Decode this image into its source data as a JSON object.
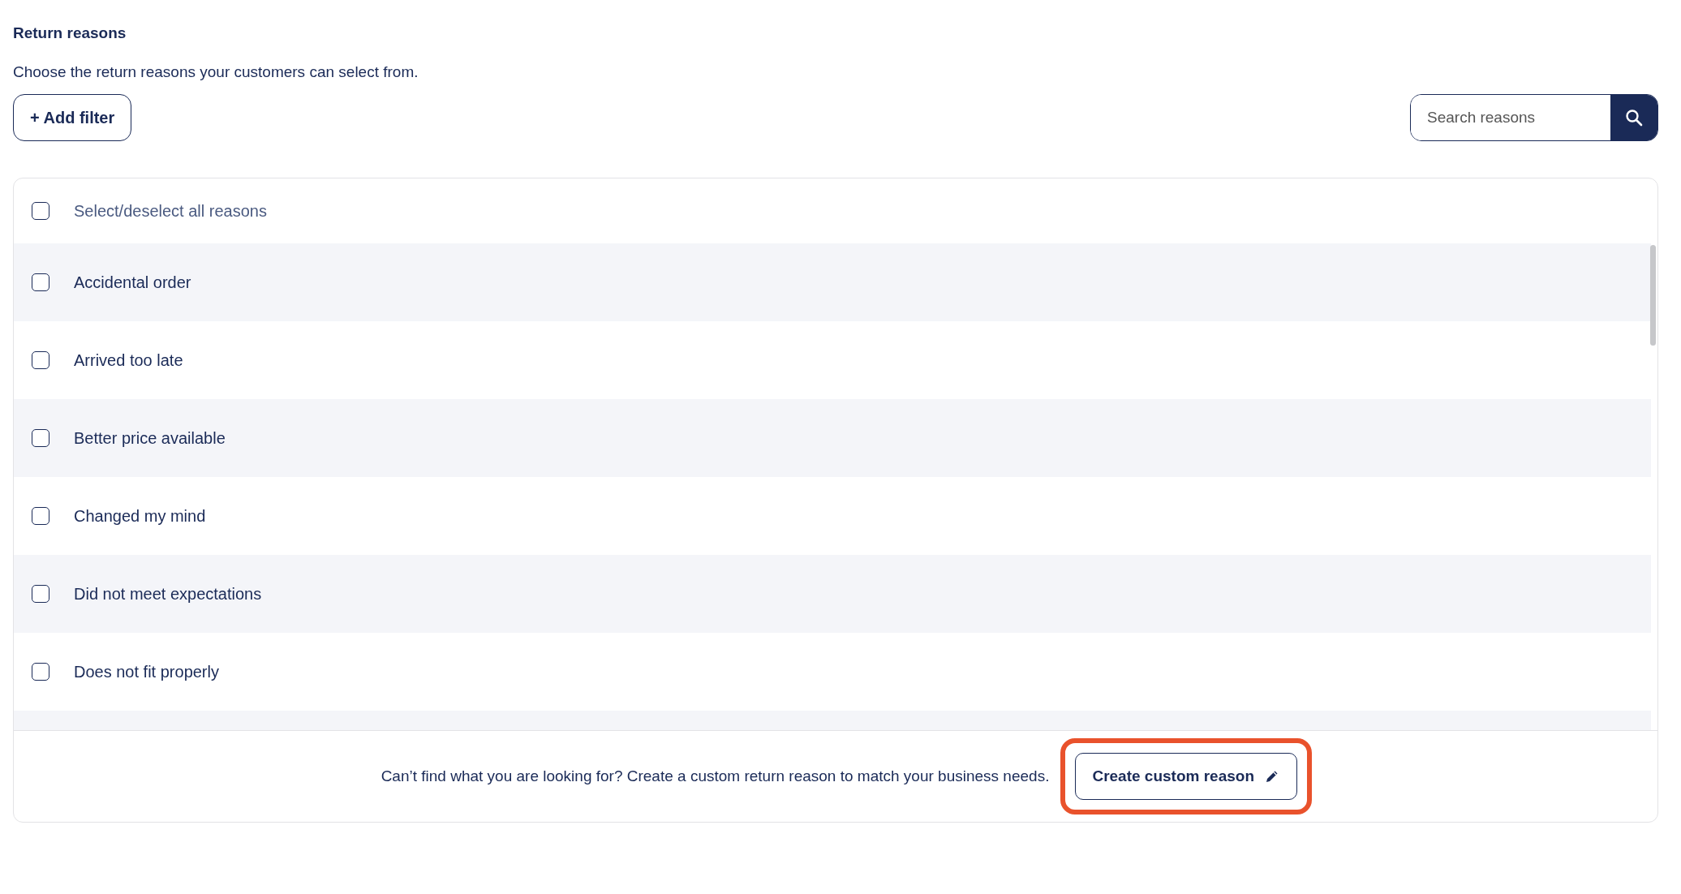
{
  "title": "Return reasons",
  "description": "Choose the return reasons your customers can select from.",
  "add_filter_button": "+ Add filter",
  "search": {
    "placeholder": "Search reasons"
  },
  "select_all": {
    "label": "Select/deselect all reasons",
    "checked": false
  },
  "reasons": [
    {
      "label": "Accidental order",
      "checked": false
    },
    {
      "label": "Arrived too late",
      "checked": false
    },
    {
      "label": "Better price available",
      "checked": false
    },
    {
      "label": "Changed my mind",
      "checked": false
    },
    {
      "label": "Did not meet expectations",
      "checked": false
    },
    {
      "label": "Does not fit properly",
      "checked": false
    }
  ],
  "footer": {
    "text": "Can’t find what you are looking for? Create a custom return reason to match your business needs.",
    "button": "Create custom reason",
    "highlighted": true
  }
}
